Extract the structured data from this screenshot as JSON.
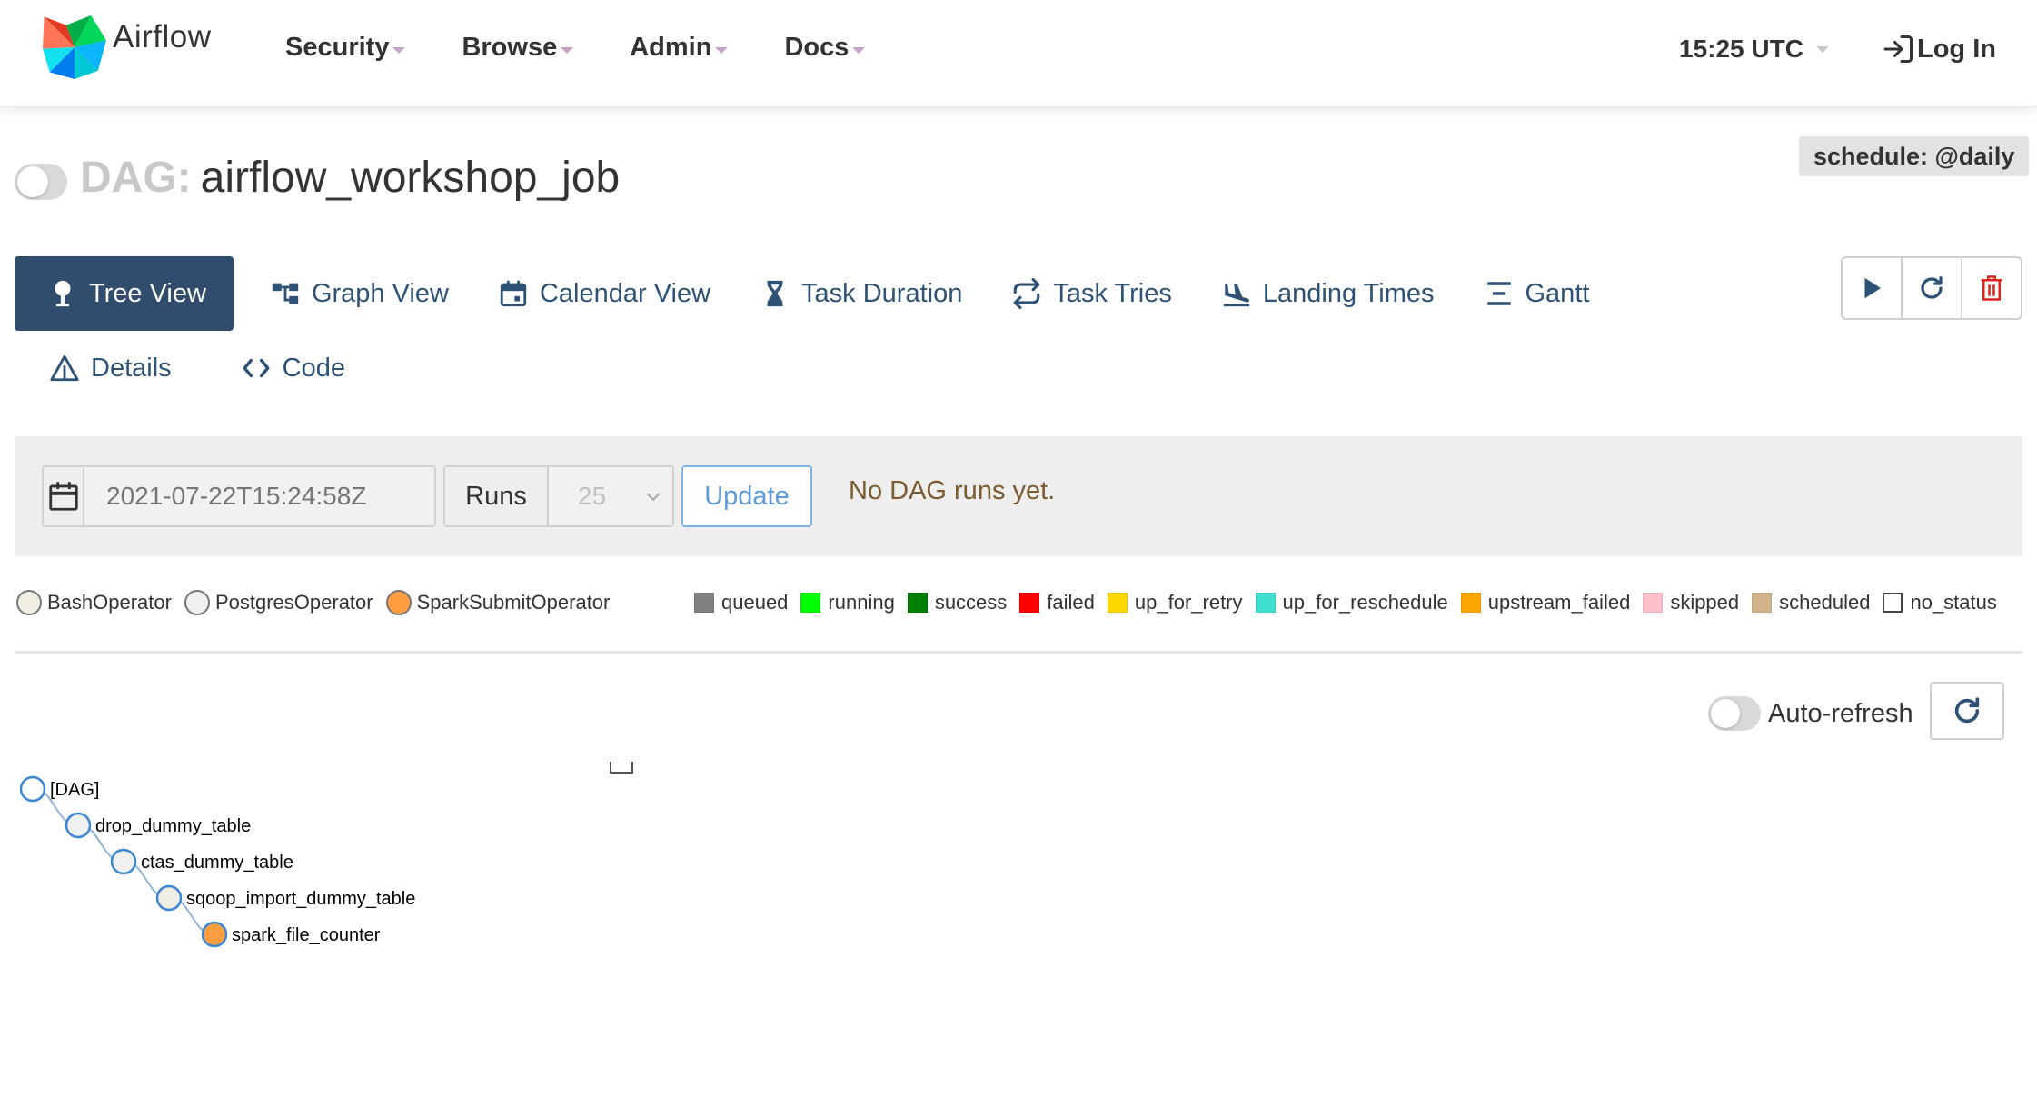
{
  "navbar": {
    "brand": "Airflow",
    "menu": [
      {
        "label": "Security"
      },
      {
        "label": "Browse"
      },
      {
        "label": "Admin"
      },
      {
        "label": "Docs"
      }
    ],
    "time": "15:25 UTC",
    "login": "Log In"
  },
  "dag": {
    "prefix": "DAG:",
    "name": "airflow_workshop_job",
    "schedule": "schedule: @daily"
  },
  "tabs": [
    {
      "label": "Tree View",
      "icon": "tree-icon",
      "active": true
    },
    {
      "label": "Graph View",
      "icon": "graph-icon"
    },
    {
      "label": "Calendar View",
      "icon": "calendar-icon"
    },
    {
      "label": "Task Duration",
      "icon": "hourglass-icon"
    },
    {
      "label": "Task Tries",
      "icon": "repeat-icon"
    },
    {
      "label": "Landing Times",
      "icon": "plane-landing-icon"
    },
    {
      "label": "Gantt",
      "icon": "gantt-icon"
    }
  ],
  "tabs_secondary": [
    {
      "label": "Details",
      "icon": "warning-triangle-icon"
    },
    {
      "label": "Code",
      "icon": "code-icon"
    }
  ],
  "actions": [
    {
      "name": "trigger",
      "icon": "play-icon"
    },
    {
      "name": "refresh",
      "icon": "refresh-icon"
    },
    {
      "name": "delete",
      "icon": "trash-icon"
    }
  ],
  "filter": {
    "base_date_placeholder": "2021-07-22T15:24:58Z",
    "runs_label": "Runs",
    "runs_value": "25",
    "update_label": "Update",
    "message": "No DAG runs yet."
  },
  "operators": [
    {
      "label": "BashOperator",
      "color": "#f0ede4"
    },
    {
      "label": "PostgresOperator",
      "color": "#f0f0f0"
    },
    {
      "label": "SparkSubmitOperator",
      "color": "#ff9e40"
    }
  ],
  "states": [
    {
      "label": "queued",
      "color": "#808080"
    },
    {
      "label": "running",
      "color": "#00ff00"
    },
    {
      "label": "success",
      "color": "#008000"
    },
    {
      "label": "failed",
      "color": "#ff0000"
    },
    {
      "label": "up_for_retry",
      "color": "#ffd700"
    },
    {
      "label": "up_for_reschedule",
      "color": "#40e0d0"
    },
    {
      "label": "upstream_failed",
      "color": "#ffa500"
    },
    {
      "label": "skipped",
      "color": "#ffc0cb"
    },
    {
      "label": "scheduled",
      "color": "#d2b48c"
    },
    {
      "label": "no_status",
      "color": "#ffffff"
    }
  ],
  "auto_refresh": {
    "label": "Auto-refresh",
    "enabled": false
  },
  "tree": {
    "nodes": [
      {
        "label": "[DAG]",
        "fill": "#ffffff",
        "depth": 0
      },
      {
        "label": "drop_dummy_table",
        "fill": "#f0f0f0",
        "depth": 1
      },
      {
        "label": "ctas_dummy_table",
        "fill": "#f0f0f0",
        "depth": 2
      },
      {
        "label": "sqoop_import_dummy_table",
        "fill": "#f0ede4",
        "depth": 3
      },
      {
        "label": "spark_file_counter",
        "fill": "#ff9e40",
        "depth": 4
      }
    ]
  }
}
